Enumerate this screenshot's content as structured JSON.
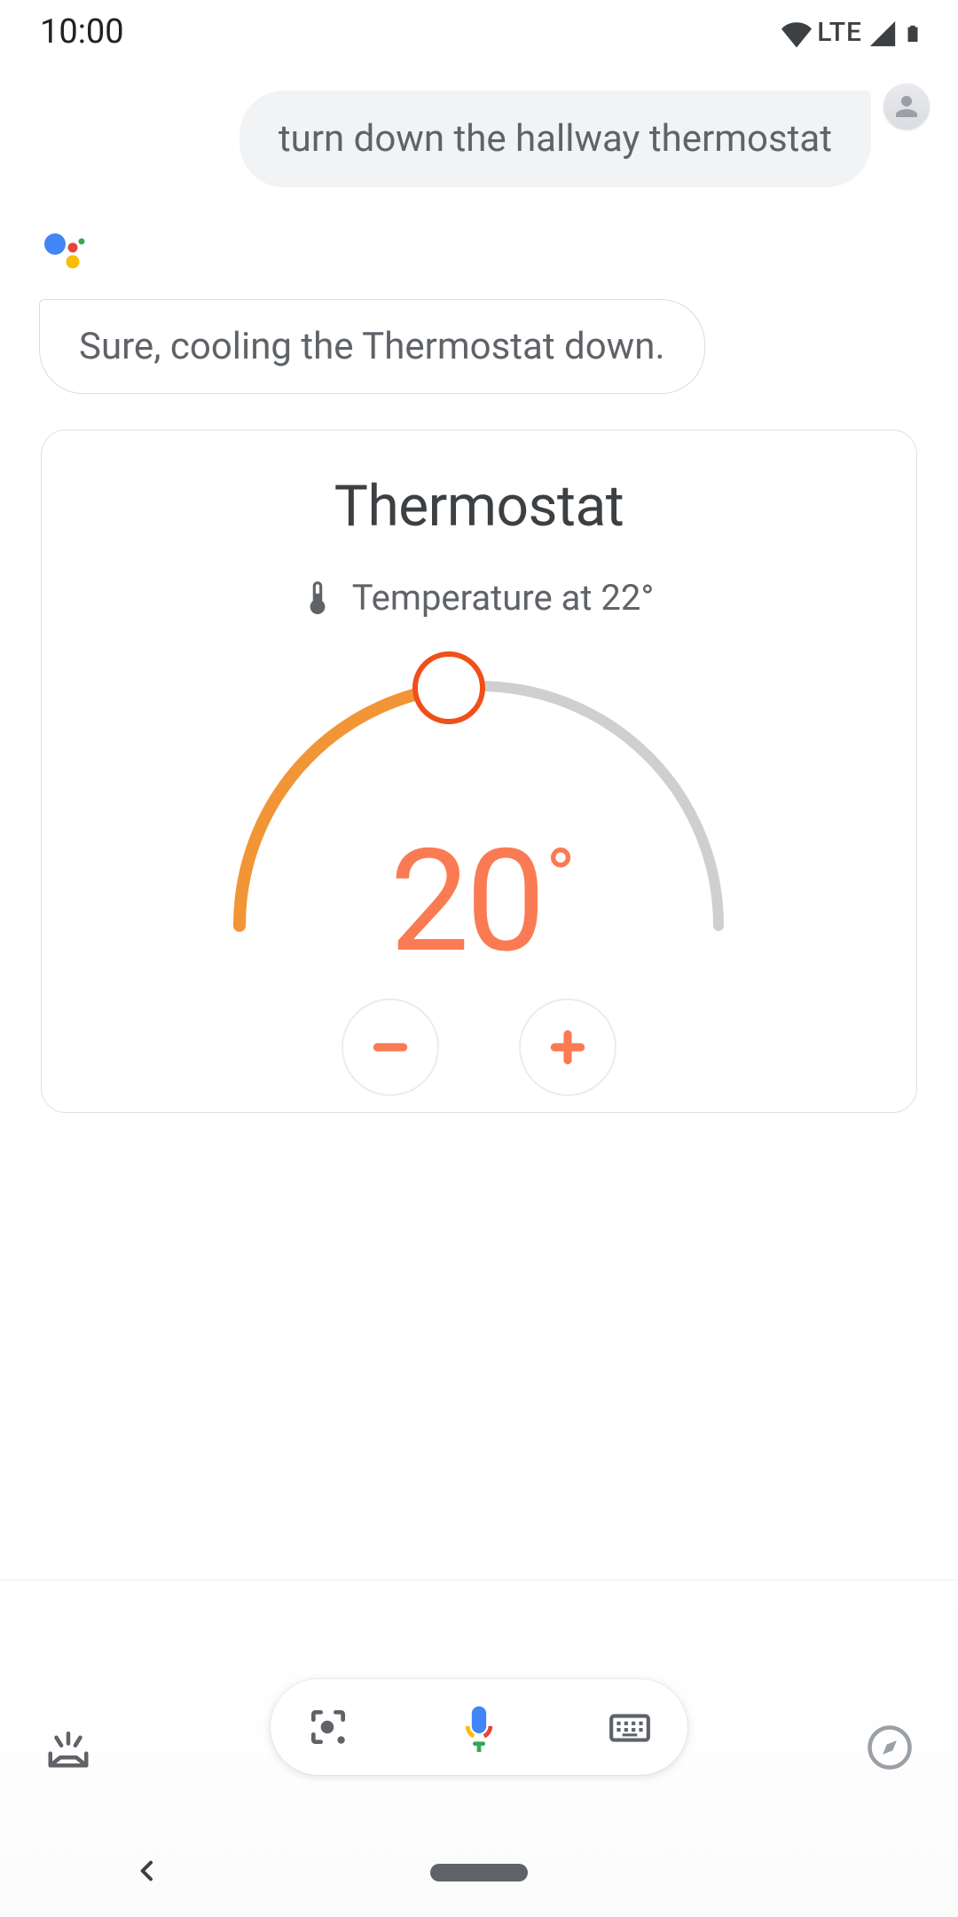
{
  "status": {
    "time": "10:00",
    "network": "LTE"
  },
  "conversation": {
    "user_text": "turn down the hallway thermostat",
    "assistant_text": "Sure, cooling the Thermostat down."
  },
  "thermostat": {
    "title": "Thermostat",
    "current_label": "Temperature at 22°",
    "setpoint_value": "20",
    "setpoint_degree": "°",
    "accent_color": "#f29537",
    "setpoint_text_color": "#fa7b53",
    "track_color": "#cfcfcf",
    "arc_fill_ratio": 0.46
  },
  "icons": {
    "wifi": "wifi-icon",
    "signal": "cell-signal-icon",
    "battery": "battery-icon",
    "avatar": "person-icon",
    "assistant": "google-assistant-icon",
    "thermometer": "thermometer-icon",
    "minus": "minus-icon",
    "plus": "plus-icon",
    "updates": "updates-icon",
    "lens": "google-lens-icon",
    "mic": "microphone-icon",
    "keyboard": "keyboard-icon",
    "explore": "compass-icon",
    "back": "back-icon"
  }
}
